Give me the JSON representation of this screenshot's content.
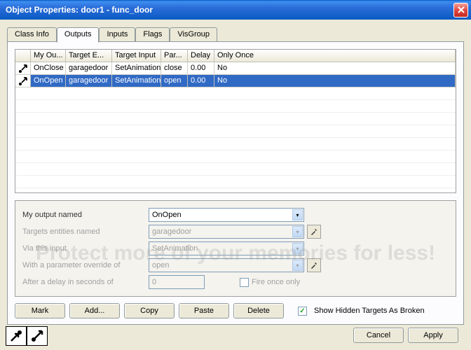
{
  "window": {
    "title": "Object Properties: door1 - func_door"
  },
  "tabs": [
    "Class Info",
    "Outputs",
    "Inputs",
    "Flags",
    "VisGroup"
  ],
  "active_tab": 1,
  "grid": {
    "headers": [
      "",
      "My Ou...",
      "Target E...",
      "Target Input",
      "Par...",
      "Delay",
      "Only Once"
    ],
    "rows": [
      {
        "icon": "out",
        "my_output": "OnClose",
        "target": "garagedoor",
        "input": "SetAnimation",
        "param": "close",
        "delay": "0.00",
        "once": "No",
        "sel": false
      },
      {
        "icon": "out",
        "my_output": "OnOpen",
        "target": "garagedoor",
        "input": "SetAnimation",
        "param": "open",
        "delay": "0.00",
        "once": "No",
        "sel": true
      }
    ]
  },
  "form": {
    "labels": {
      "my_output": "My output named",
      "targets": "Targets entities named",
      "via": "Via this input",
      "param": "With a parameter override of",
      "delay": "After a delay in seconds of",
      "fire_once": "Fire once only"
    },
    "values": {
      "my_output": "OnOpen",
      "targets": "garagedoor",
      "via": "SetAnimation",
      "param": "open",
      "delay": "0",
      "fire_once": false
    }
  },
  "buttons": {
    "mark": "Mark",
    "add": "Add...",
    "copy": "Copy",
    "paste": "Paste",
    "delete": "Delete",
    "cancel": "Cancel",
    "apply": "Apply"
  },
  "show_hidden": {
    "label": "Show Hidden Targets As Broken",
    "checked": true
  },
  "watermark": "Protect more of your memories for less!"
}
